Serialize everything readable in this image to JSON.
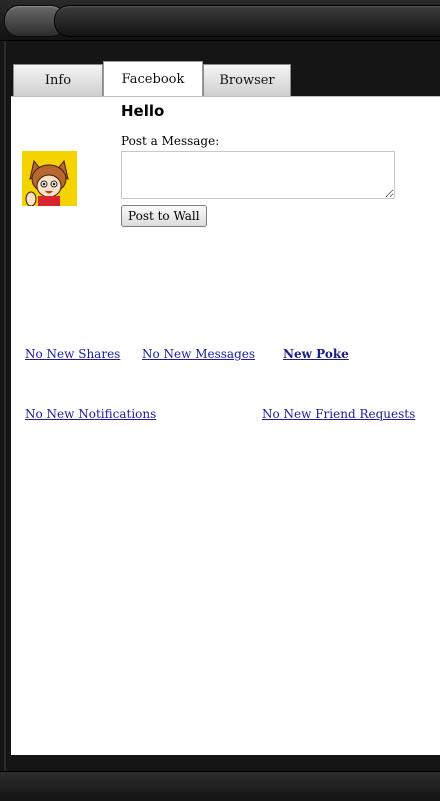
{
  "tabs": [
    {
      "label": "Info",
      "active": false
    },
    {
      "label": "Facebook",
      "active": true
    },
    {
      "label": "Browser",
      "active": false
    }
  ],
  "facebook": {
    "greeting": "Hello",
    "post_label": "Post a Message:",
    "message_value": "",
    "post_button": "Post to Wall",
    "links": {
      "shares": "No New Shares",
      "messages": "No New Messages",
      "poke": "New Poke",
      "notifications": "No New Notifications",
      "friend_requests": "No New Friend Requests"
    }
  },
  "colors": {
    "link": "#1a1aa6",
    "avatar_background": "#f4d300"
  }
}
